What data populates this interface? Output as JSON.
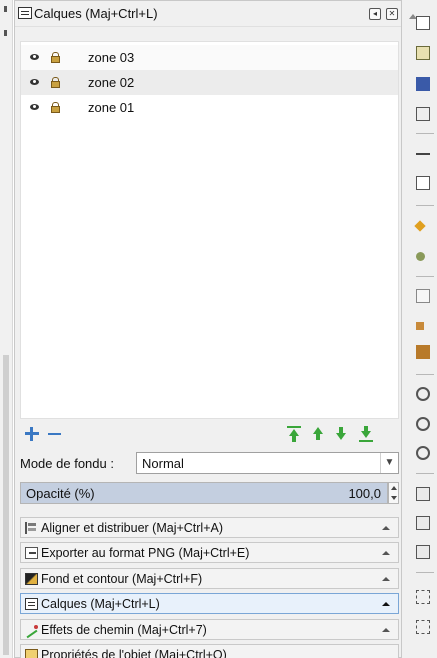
{
  "panel": {
    "title": "Calques (Maj+Ctrl+L)"
  },
  "layers": [
    {
      "name": "zone 03"
    },
    {
      "name": "zone 02"
    },
    {
      "name": "zone 01"
    }
  ],
  "blend": {
    "label": "Mode de fondu :",
    "value": "Normal"
  },
  "opacity": {
    "label": "Opacité (%)",
    "value": "100,0",
    "fraction": 1.0
  },
  "dock_tabs": [
    {
      "label": "Aligner et distribuer (Maj+Ctrl+A)",
      "icon": "align-icon"
    },
    {
      "label": "Exporter au format PNG (Maj+Ctrl+E)",
      "icon": "export-icon"
    },
    {
      "label": "Fond et contour (Maj+Ctrl+F)",
      "icon": "fill-stroke-icon"
    },
    {
      "label": "Calques (Maj+Ctrl+L)",
      "icon": "layers-icon",
      "active": true
    },
    {
      "label": "Effets de chemin (Maj+Ctrl+7)",
      "icon": "path-effects-icon"
    },
    {
      "label": "Propriétés de l'objet (Maj+Ctrl+O)",
      "icon": "object-properties-icon"
    }
  ],
  "colors": {
    "accent": "#3a78c3",
    "move_arrows": "#3aa63a",
    "active_tab": "#e8f1fb"
  }
}
